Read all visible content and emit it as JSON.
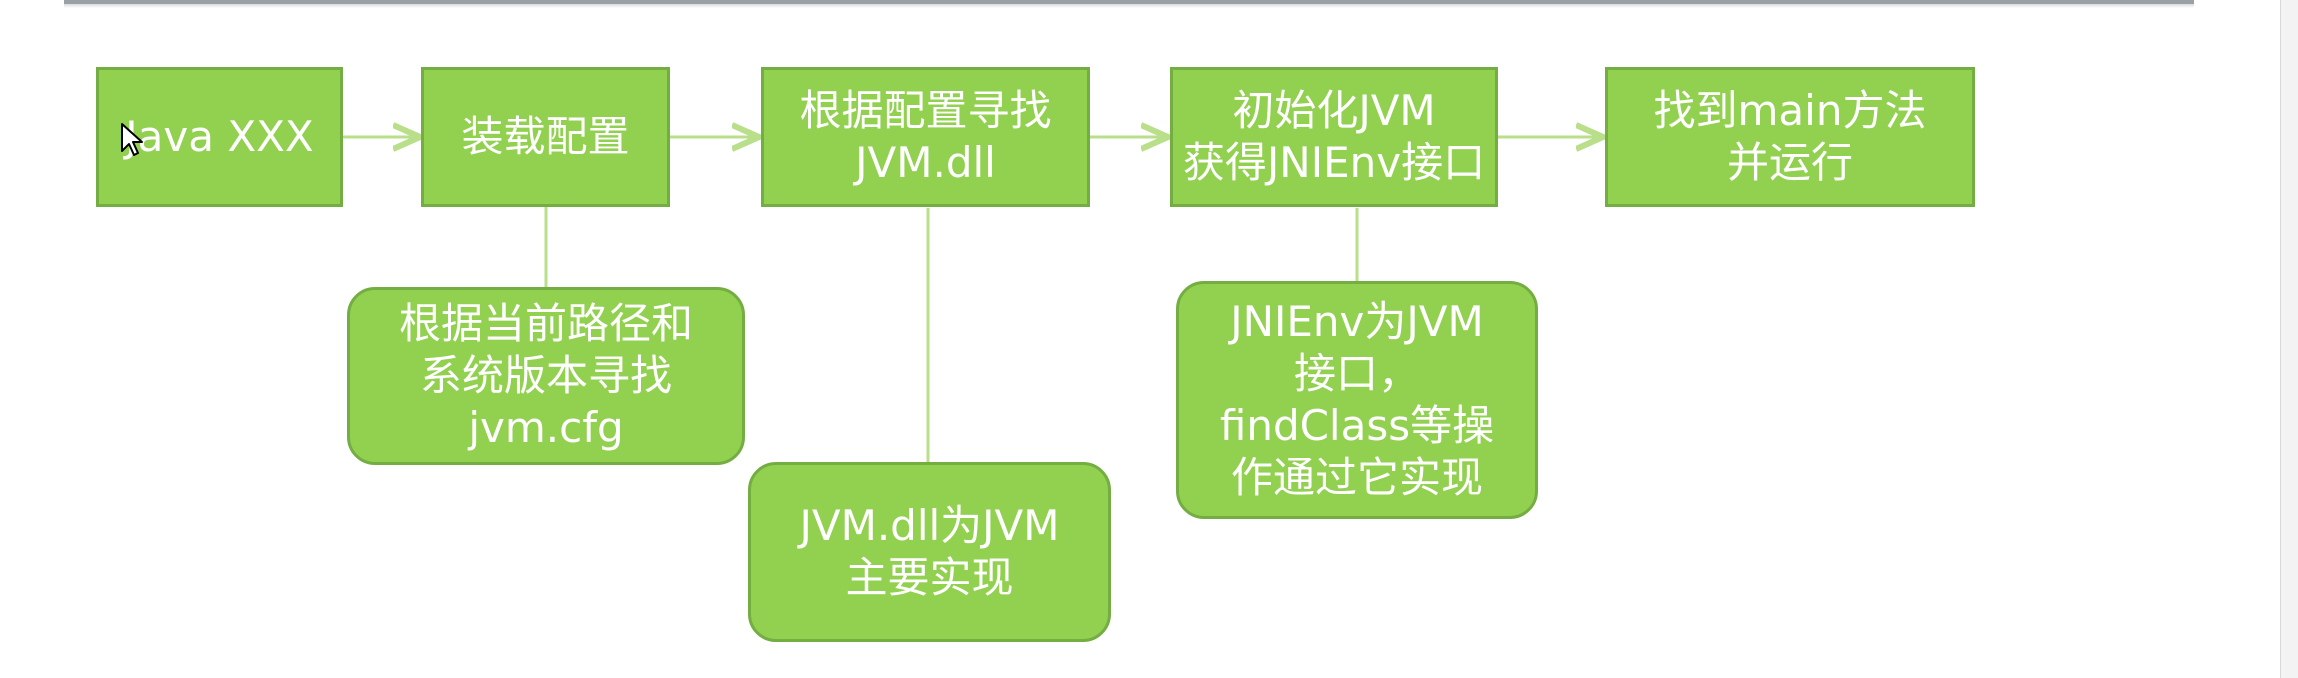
{
  "diagram": {
    "steps": [
      "Java XXX",
      "装载配置",
      "根据配置寻找\nJVM.dll",
      "初始化JVM\n获得JNIEnv接口",
      "找到main方法\n并运行"
    ],
    "notes": [
      "根据当前路径和\n系统版本寻找\njvm.cfg",
      "JVM.dll为JVM\n主要实现",
      "JNIEnv为JVM\n接口，\nfindClass等操\n作通过它实现"
    ]
  },
  "colors": {
    "box_fill": "#92d050",
    "box_border": "#74ad42",
    "connector": "#b9df8a"
  }
}
